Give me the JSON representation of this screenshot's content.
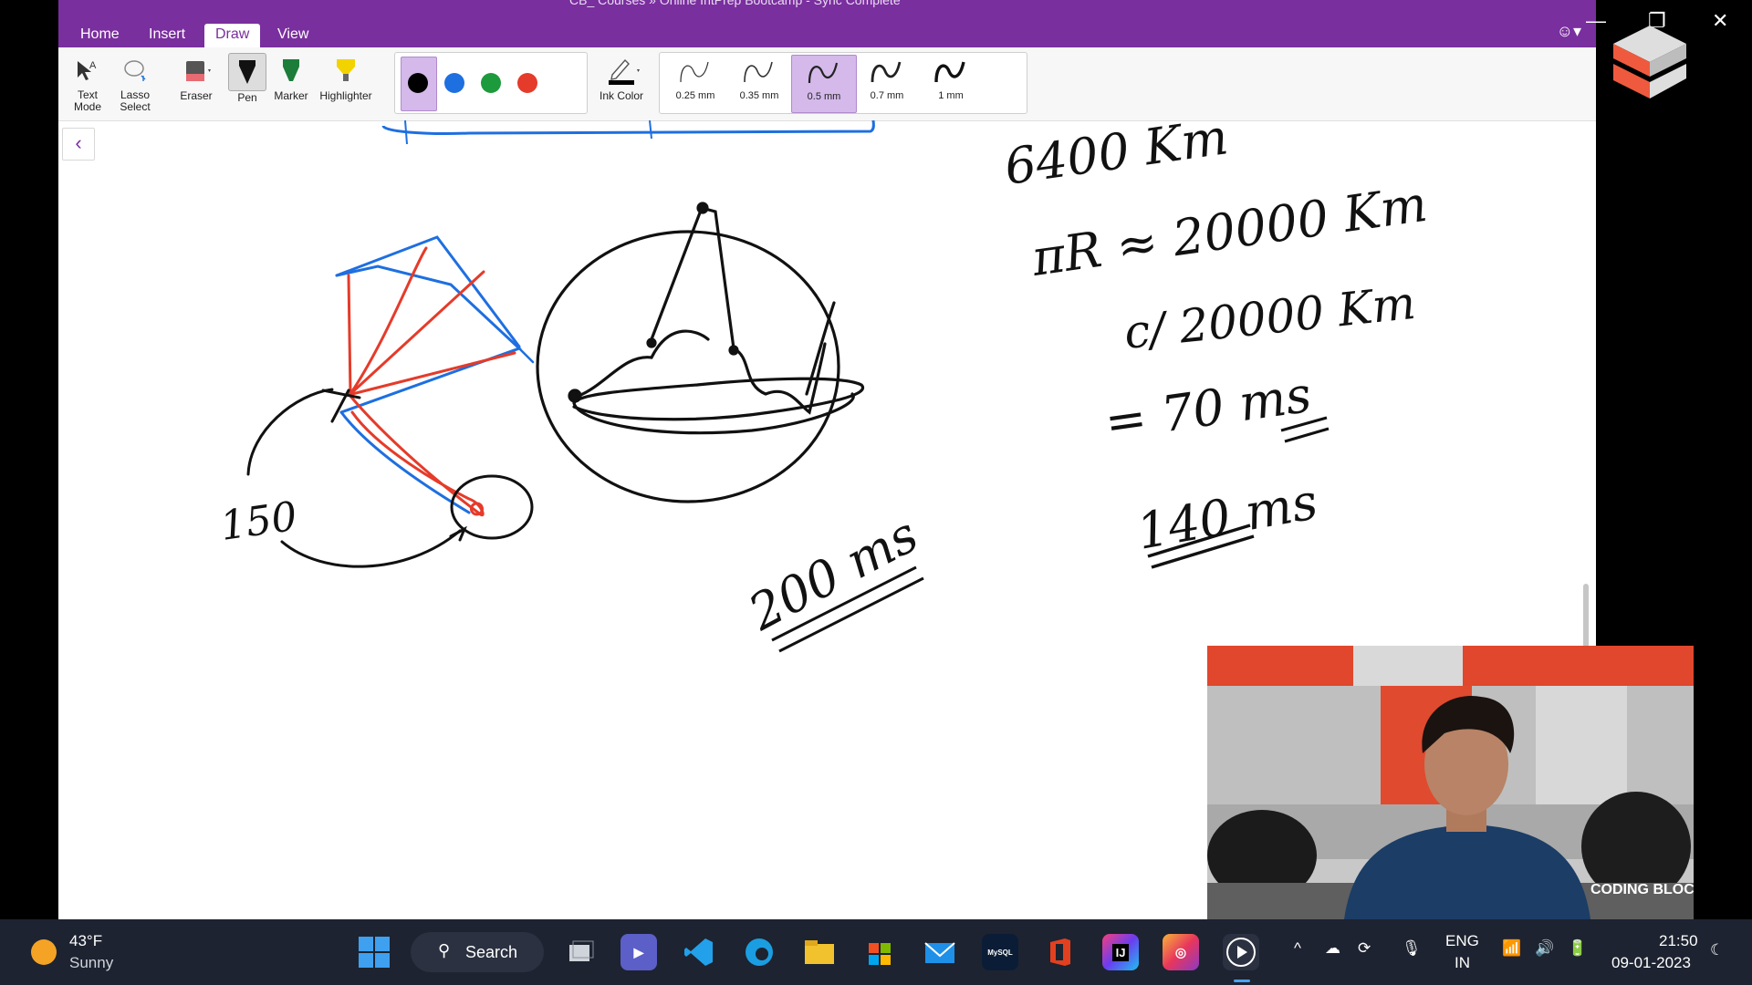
{
  "window": {
    "title": "CB_ Courses  »  Online IntPrep Bootcamp - Sync Complete",
    "tabs": [
      {
        "label": "Home",
        "active": false
      },
      {
        "label": "Insert",
        "active": false
      },
      {
        "label": "Draw",
        "active": true
      },
      {
        "label": "View",
        "active": false
      }
    ]
  },
  "ribbon": {
    "tools": {
      "text_mode": "Text Mode",
      "lasso_select": "Lasso Select",
      "eraser": "Eraser",
      "pen": "Pen",
      "marker": "Marker",
      "highlighter": "Highlighter",
      "ink_color": "Ink Color"
    },
    "pen_colors": [
      "#000000",
      "#1e6fe0",
      "#1d9a3c",
      "#e53b2a"
    ],
    "selected_color": "#000000",
    "thickness": [
      "0.25 mm",
      "0.35 mm",
      "0.5 mm",
      "0.7 mm",
      "1 mm"
    ],
    "selected_thickness": "0.5 mm"
  },
  "notes": {
    "radius": "6400 Km",
    "circumference": "πR ≈ 20000 Km",
    "divide": "c/ 20000 Km",
    "result": "= 70 ms",
    "round_trip": "140 ms",
    "label_150": "150",
    "label_200": "200 ms"
  },
  "taskbar": {
    "weather_temp": "43°F",
    "weather_desc": "Sunny",
    "search_label": "Search",
    "language": "ENG",
    "region": "IN",
    "time": "21:50",
    "date": "09-01-2023"
  },
  "webcam": {
    "brand": "CODING BLOCKS"
  }
}
